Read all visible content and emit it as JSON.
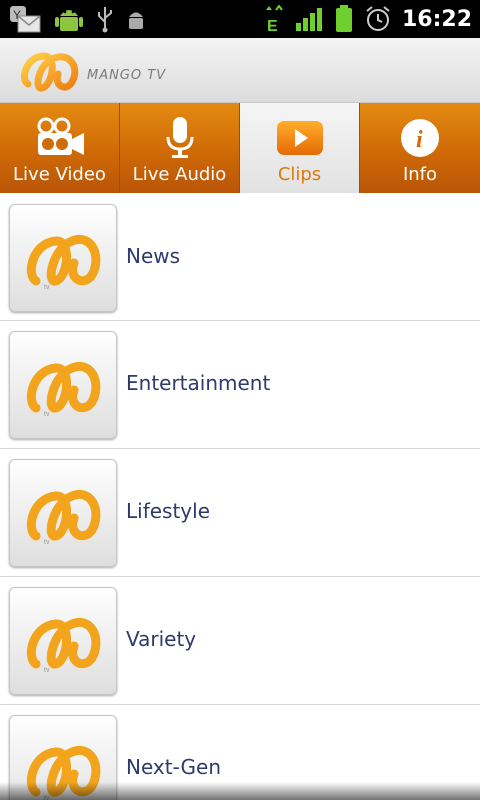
{
  "status_bar": {
    "time": "16:22",
    "icons": [
      "yahoo-mail-icon",
      "android-icon",
      "usb-icon",
      "debug-icon",
      "edge-data-icon",
      "signal-icon",
      "battery-icon",
      "alarm-icon"
    ]
  },
  "app": {
    "brand": "MANGO TV",
    "logo_icon": "mango-tv-logo"
  },
  "tabs": [
    {
      "label": "Live Video",
      "icon": "video-camera-icon",
      "active": false
    },
    {
      "label": "Live Audio",
      "icon": "microphone-icon",
      "active": false
    },
    {
      "label": "Clips",
      "icon": "play-icon",
      "active": true
    },
    {
      "label": "Info",
      "icon": "info-icon",
      "active": false
    }
  ],
  "categories": [
    {
      "label": "News"
    },
    {
      "label": "Entertainment"
    },
    {
      "label": "Lifestyle"
    },
    {
      "label": "Variety"
    },
    {
      "label": "Next-Gen"
    }
  ],
  "colors": {
    "tab_orange": "#cf6a07",
    "active_label": "#e07808",
    "list_text": "#2e3a6e"
  }
}
